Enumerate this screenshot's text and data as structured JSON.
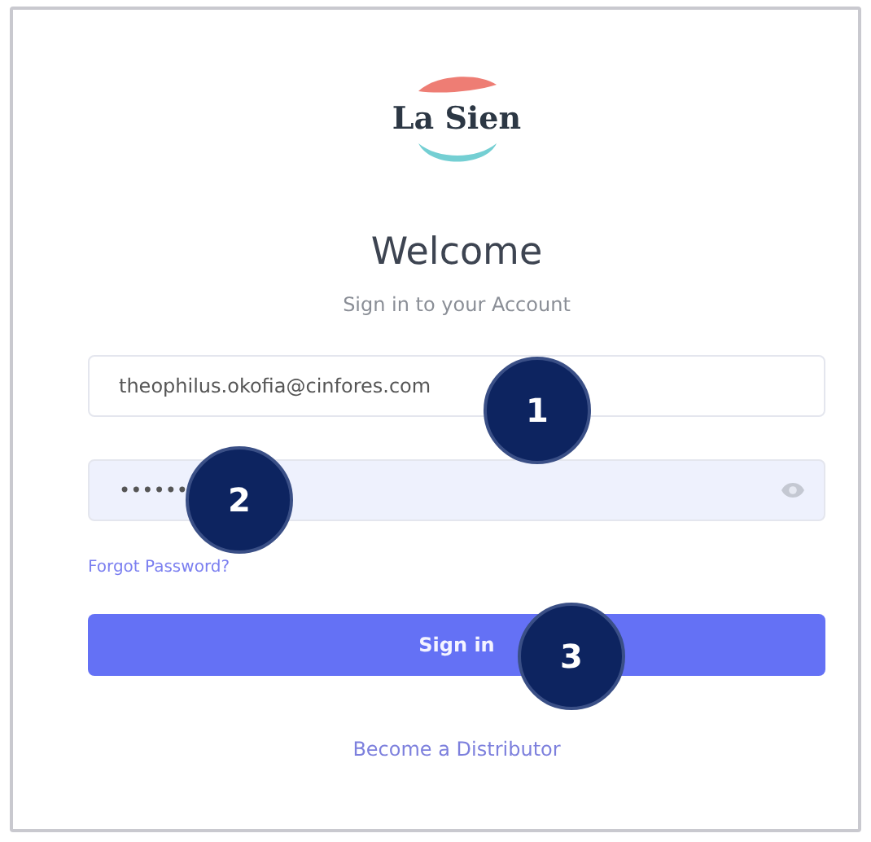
{
  "logo": {
    "text": "La Sien"
  },
  "heading": "Welcome",
  "subheading": "Sign in to your Account",
  "email_field": {
    "value": "theophilus.okofia@cinfores.com"
  },
  "password_field": {
    "value": "••••••"
  },
  "forgot_link": "Forgot Password?",
  "sign_in_button": "Sign in",
  "distributor_link": "Become a Distributor",
  "callouts": [
    {
      "number": "1"
    },
    {
      "number": "2"
    },
    {
      "number": "3"
    }
  ]
}
